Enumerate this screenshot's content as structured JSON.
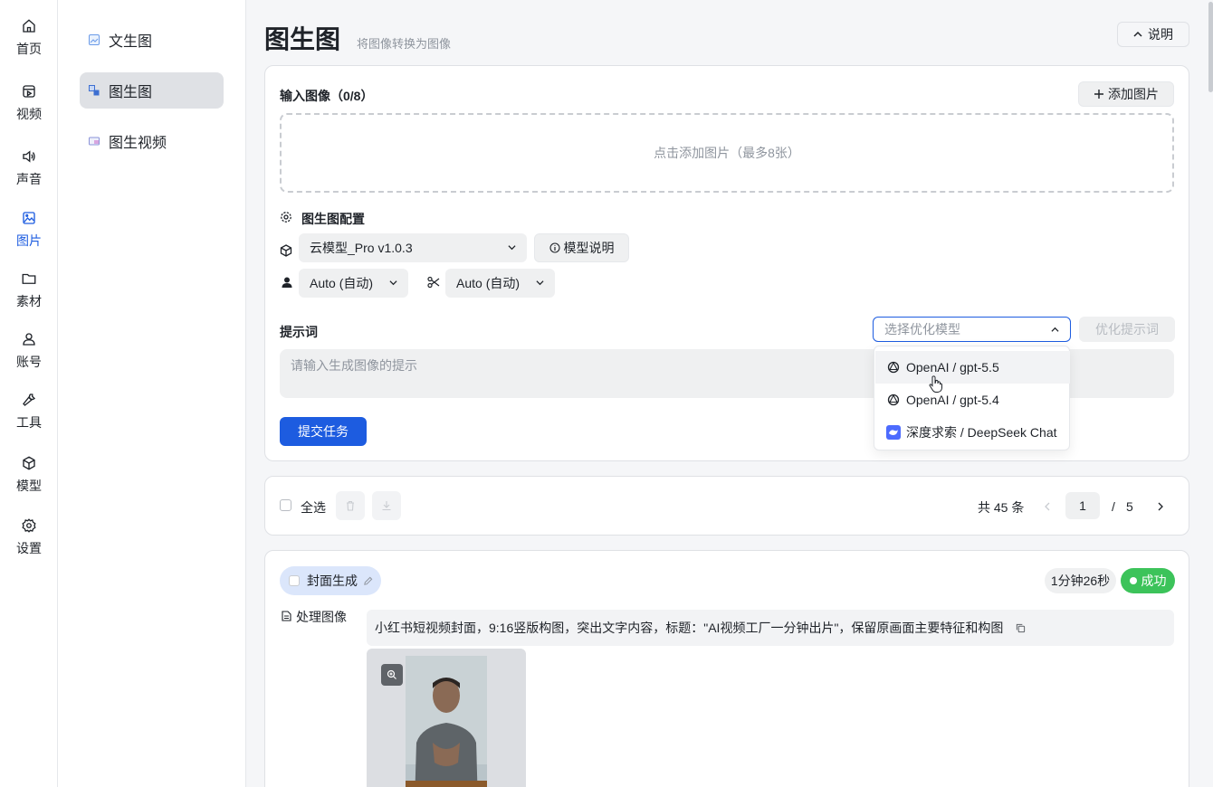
{
  "rail": [
    {
      "label": "首页",
      "icon": "home-icon"
    },
    {
      "label": "视频",
      "icon": "video-icon"
    },
    {
      "label": "声音",
      "icon": "sound-icon"
    },
    {
      "label": "图片",
      "icon": "image-icon"
    },
    {
      "label": "素材",
      "icon": "folder-icon"
    },
    {
      "label": "账号",
      "icon": "user-icon"
    },
    {
      "label": "工具",
      "icon": "wrench-icon"
    },
    {
      "label": "模型",
      "icon": "model-icon"
    },
    {
      "label": "设置",
      "icon": "gear-icon"
    }
  ],
  "rail_active": "图片",
  "subnav": [
    {
      "label": "文生图"
    },
    {
      "label": "图生图"
    },
    {
      "label": "图生视频"
    }
  ],
  "subnav_active": "图生图",
  "header": {
    "title": "图生图",
    "subtitle": "将图像转换为图像",
    "explain_label": "说明"
  },
  "input": {
    "title": "输入图像（0/8）",
    "add_label": "添加图片",
    "dropzone_text": "点击添加图片（最多8张）"
  },
  "config": {
    "title": "图生图配置",
    "model_value": "云模型_Pro v1.0.3",
    "model_info_label": "模型说明",
    "person_value": "Auto (自动)",
    "cut_value": "Auto (自动)"
  },
  "prompt": {
    "label": "提示词",
    "optimize_placeholder": "选择优化模型",
    "optimize_button": "优化提示词",
    "placeholder": "请输入生成图像的提示",
    "submit_label": "提交任务"
  },
  "dropdown": {
    "items": [
      {
        "label": "OpenAI / gpt-5.5",
        "icon": "openai-icon"
      },
      {
        "label": "OpenAI / gpt-5.4",
        "icon": "openai-icon"
      },
      {
        "label": "深度求索 / DeepSeek Chat",
        "icon": "deepseek-icon"
      }
    ]
  },
  "toolbar": {
    "select_all_label": "全选",
    "total_text": "共 45 条",
    "current_page": "1",
    "page_sep": "/",
    "total_pages": "5"
  },
  "task": {
    "tag_label": "封面生成",
    "duration": "1分钟26秒",
    "status": "成功",
    "section_label": "处理图像",
    "description": "小红书短视频封面，9:16竖版构图，突出文字内容，标题：\"AI视频工厂一分钟出片\"，保留原画面主要特征和构图"
  },
  "colors": {
    "accent": "#1d5ce0",
    "success": "#3cc35a",
    "active_bg": "#dfe1e5"
  }
}
